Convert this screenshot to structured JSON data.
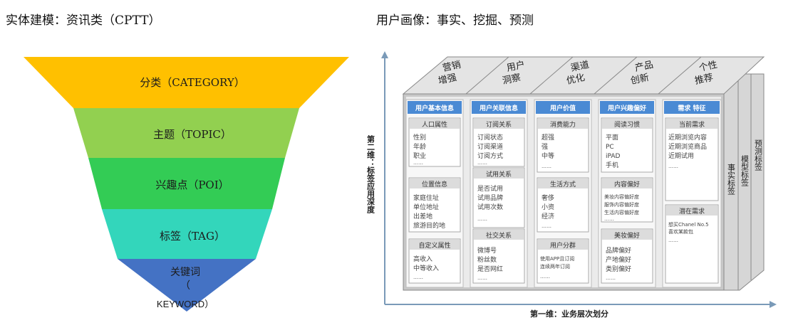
{
  "left_title": "实体建模：资讯类（CPTT）",
  "right_title": "用户画像：事实、挖掘、预测",
  "funnel": {
    "levels": [
      "分类（CATEGORY）",
      "主题（TOPIC）",
      "兴趣点（POI）",
      "标签（TAG）"
    ],
    "last_level": {
      "line1": "关键词",
      "line2": "（",
      "line3": "KEYWORD）"
    },
    "colors": [
      "#FFC000",
      "#92D050",
      "#33CC55",
      "#33CCBB",
      "#4472C4"
    ]
  },
  "cube": {
    "roof": [
      {
        "line1": "营销",
        "line2": "增强"
      },
      {
        "line1": "用户",
        "line2": "洞察"
      },
      {
        "line1": "渠道",
        "line2": "优化"
      },
      {
        "line1": "产品",
        "line2": "创新"
      },
      {
        "line1": "个性",
        "line2": "推荐"
      }
    ],
    "columns": [
      {
        "header": "用户基本信息",
        "sections": [
          {
            "title": "人口属性",
            "items": [
              "性别",
              "年龄",
              "职业",
              "……"
            ]
          },
          {
            "title": "位置信息",
            "items": [
              "家庭住址",
              "单位地址",
              "出差地",
              "旅游目的地"
            ]
          },
          {
            "title": "自定义属性",
            "items": [
              "高收入",
              "中等收入",
              "……"
            ]
          }
        ]
      },
      {
        "header": "用户关联信息",
        "sections": [
          {
            "title": "订阅关系",
            "items": [
              "订阅状态",
              "订阅渠道",
              "订阅方式",
              "……"
            ]
          },
          {
            "title": "试用关系",
            "items": [
              "是否试用",
              "试用品牌",
              "试用次数",
              "……"
            ]
          },
          {
            "title": "社交关系",
            "items": [
              "微博号",
              "粉丝数",
              "是否网红",
              "……"
            ]
          }
        ]
      },
      {
        "header": "用户价值",
        "sections": [
          {
            "title": "消费能力",
            "items": [
              "超强",
              "强",
              "中等",
              "……"
            ]
          },
          {
            "title": "生活方式",
            "items": [
              "奢侈",
              "小资",
              "经济",
              "……"
            ]
          },
          {
            "title": "用户分群",
            "items": [
              "使用APP且订阅",
              "连续两年订阅",
              "……"
            ]
          }
        ]
      },
      {
        "header": "用户兴趣偏好",
        "sections": [
          {
            "title": "阅读习惯",
            "items": [
              "平面",
              "PC",
              "iPAD",
              "手机"
            ]
          },
          {
            "title": "内容偏好",
            "items": [
              "美妆内容偏好度",
              "服饰内容偏好度",
              "生活内容偏好度",
              "……"
            ]
          },
          {
            "title": "美妆偏好",
            "items": [
              "品牌偏好",
              "产地偏好",
              "类别偏好",
              "……"
            ]
          }
        ]
      },
      {
        "header": "需求 特征",
        "sections": [
          {
            "title": "当前需求",
            "items": [
              "近期浏览内容",
              "近期浏览商品",
              "近期试用",
              "……"
            ]
          },
          {
            "title": "潜在需求",
            "items": [
              "想买Chanel No.5",
              "喜欢某款包",
              "……"
            ]
          }
        ]
      }
    ],
    "side_labels": [
      "事实标签",
      "模型标签",
      "预测标签"
    ],
    "y_axis_label": "第二维：标签应用深度",
    "x_axis_label": "第一维：业务层次划分"
  }
}
